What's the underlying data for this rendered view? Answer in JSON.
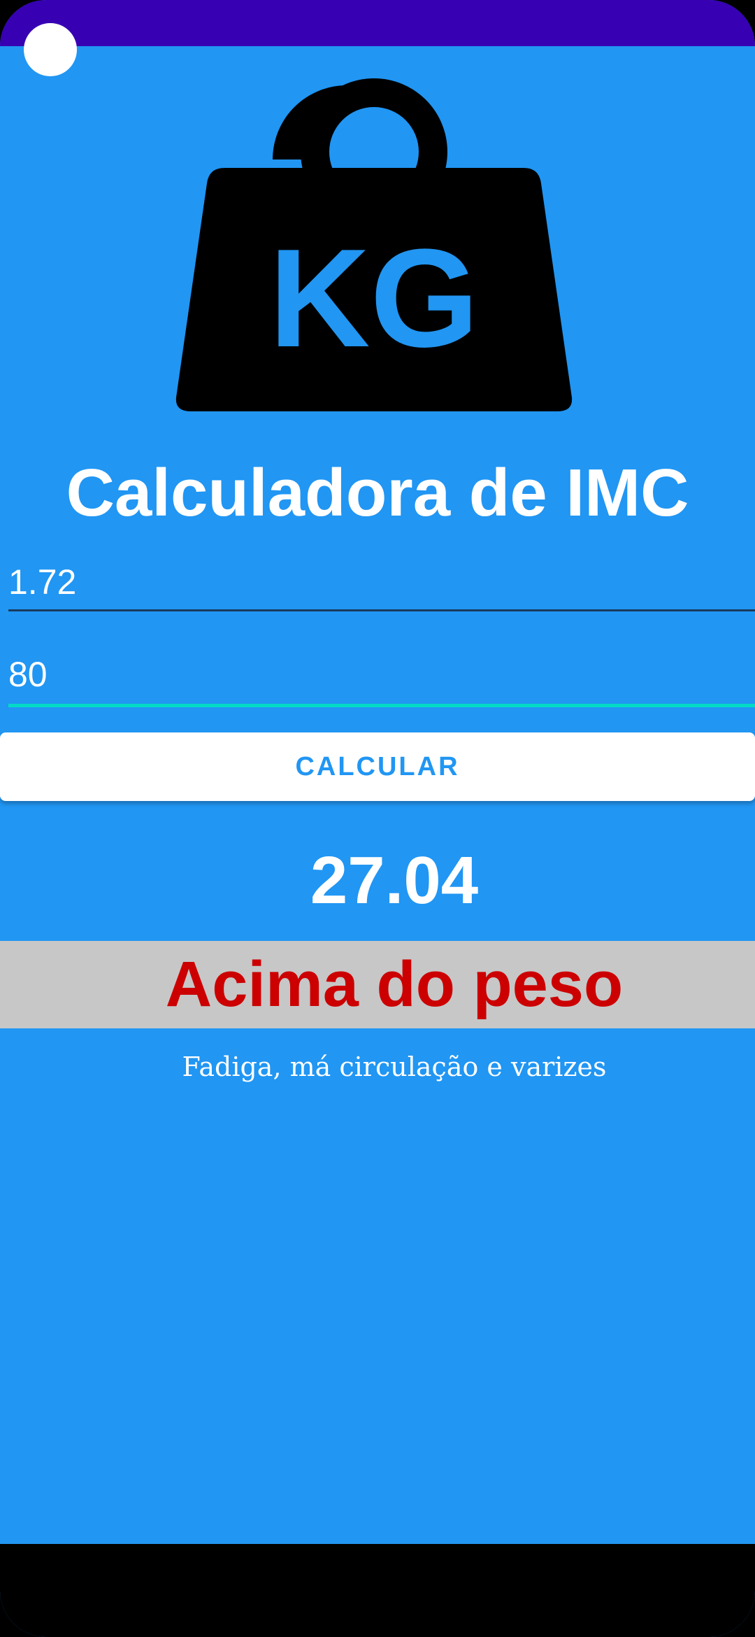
{
  "app": {
    "title": "Calculadora de IMC",
    "icon_text": "KG",
    "icon_name": "kettlebell-weight-icon"
  },
  "inputs": {
    "height_value": "1.72",
    "weight_value": "80"
  },
  "button": {
    "calculate_label": "CALCULAR"
  },
  "result": {
    "imc_value": "27.04",
    "classification": "Acima do peso",
    "description": "Fadiga, má circulação e varizes"
  },
  "colors": {
    "background": "#2196F3",
    "status_bar": "#3700B3",
    "accent": "#03DAC5",
    "classification_text": "#CC0000",
    "classification_band": "#C7C7C7"
  }
}
